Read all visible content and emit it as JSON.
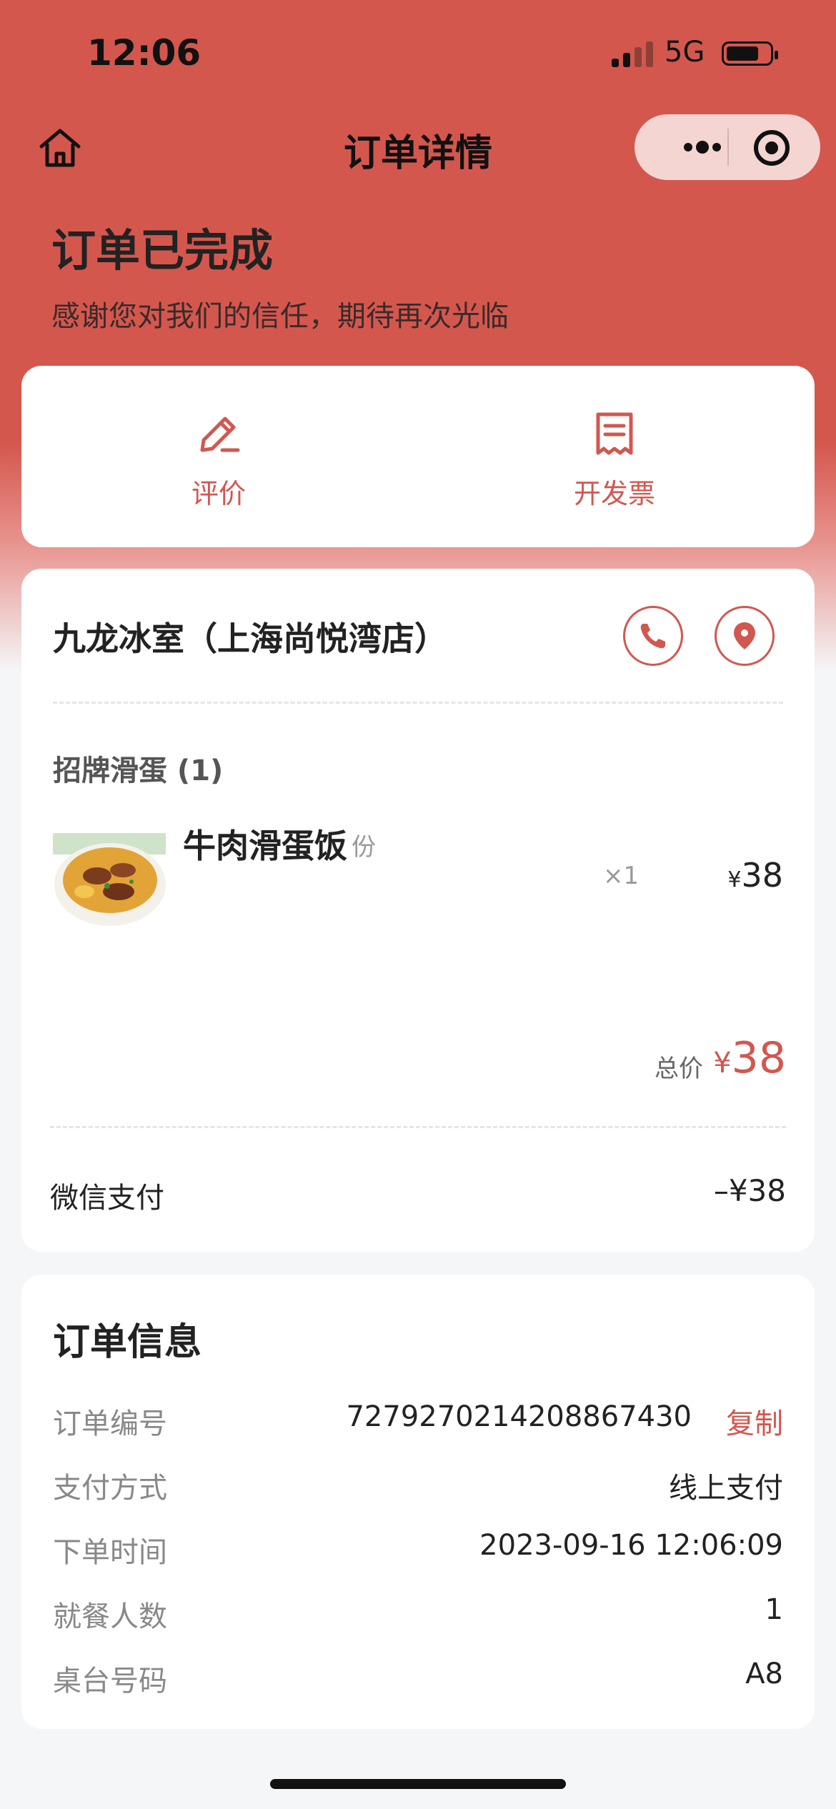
{
  "status_bar": {
    "time": "12:06",
    "network": "5G"
  },
  "nav": {
    "title": "订单详情"
  },
  "header": {
    "title": "订单已完成",
    "subtitle": "感谢您对我们的信任，期待再次光临"
  },
  "actions": [
    {
      "label": "评价",
      "icon": "edit-icon"
    },
    {
      "label": "开发票",
      "icon": "receipt-icon"
    }
  ],
  "store": {
    "name": "九龙冰室（上海尚悦湾店）",
    "category": "招牌滑蛋 (1)",
    "items": [
      {
        "name": "牛肉滑蛋饭",
        "unit": "份",
        "qty": "×1",
        "currency": "¥",
        "price": "38"
      }
    ],
    "total_label": "总价",
    "total_currency": "¥",
    "total_value": "38",
    "payment_label": "微信支付",
    "payment_value": "–¥38"
  },
  "order_info": {
    "title": "订单信息",
    "rows": [
      {
        "label": "订单编号",
        "value": "7279270214208867430",
        "action": "复制"
      },
      {
        "label": "支付方式",
        "value": "线上支付"
      },
      {
        "label": "下单时间",
        "value": "2023-09-16 12:06:09"
      },
      {
        "label": "就餐人数",
        "value": "1"
      },
      {
        "label": "桌台号码",
        "value": "A8"
      }
    ]
  },
  "colors": {
    "brand": "#d4574e",
    "accent_text": "#d2574f",
    "background": "#f5f6f8"
  }
}
